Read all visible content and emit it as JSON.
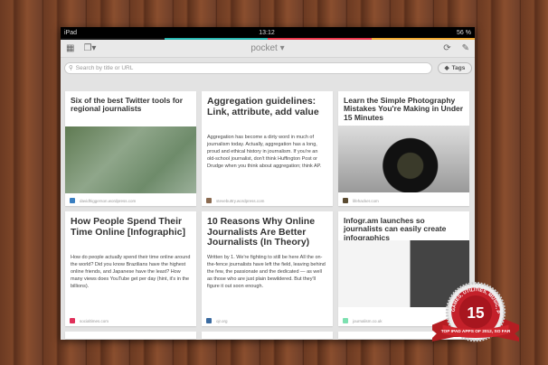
{
  "status": {
    "device": "iPad",
    "time": "13:12",
    "battery": "56 %"
  },
  "stripe_colors": [
    "#e8e8e8",
    "#26b5b0",
    "#e8354a",
    "#f0a830"
  ],
  "toolbar": {
    "title": "pocket ▾",
    "grid_icon": "grid-icon",
    "list_icon": "list-view-icon",
    "refresh_icon": "refresh-icon",
    "edit_icon": "pencil-icon"
  },
  "search": {
    "placeholder": "Search by title or URL",
    "tags_label": "Tags"
  },
  "cards": [
    {
      "title": "Six of the best Twitter tools for regional journalists",
      "source": "davidhiggerson.wordpress.com",
      "excerpt": "",
      "fav": "#3a7fc1",
      "image": "map"
    },
    {
      "title": "Aggregation guidelines: Link, attribute, add value",
      "source": "stevebuttry.wordpress.com",
      "excerpt": "Aggregation has become a dirty word in much of journalism today. Actually, aggregation has a long, proud and ethical history in journalism. If you're an old-school journalist, don't think Huffington Post or Drudge when you think about aggregation; think AP.",
      "fav": "#8a6a50",
      "image": ""
    },
    {
      "title": "Learn the Simple Photography Mistakes You're Making in Under 15 Minutes",
      "source": "lifehacker.com",
      "excerpt": "",
      "fav": "#5a4a30",
      "image": "camera"
    },
    {
      "title": "How People Spend Their Time Online [Infographic]",
      "source": "socialtimes.com",
      "excerpt": "How do people actually spend their time online around the world? Did you know Brazilians have the highest online friends, and Japanese have the least? How many views does YouTube get per day (hint, it's in the billions).",
      "fav": "#e0305a",
      "image": ""
    },
    {
      "title": "10 Reasons Why Online Journalists Are Better Journalists (In Theory)",
      "source": "ojr.org",
      "excerpt": "Written by 1. We're fighting to still be here All the on-the-fence journalists have left the field, leaving behind the few, the passionate and the dedicated — as well as those who are just plain bewildered. But they'll figure it out soon enough.",
      "fav": "#3a6aa0",
      "image": ""
    },
    {
      "title": "Infogr.am launches so journalists can easily create infographics",
      "source": "journalism.co.uk",
      "excerpt": "",
      "fav": "#7de0b0",
      "image": "sheet"
    }
  ],
  "badge": {
    "number": "15",
    "ring_text": "GAMES, UTILITIES, MUSIC, PHOTOS",
    "ribbon": "TOP IPAD APPS OF 2012, SO FAR"
  }
}
